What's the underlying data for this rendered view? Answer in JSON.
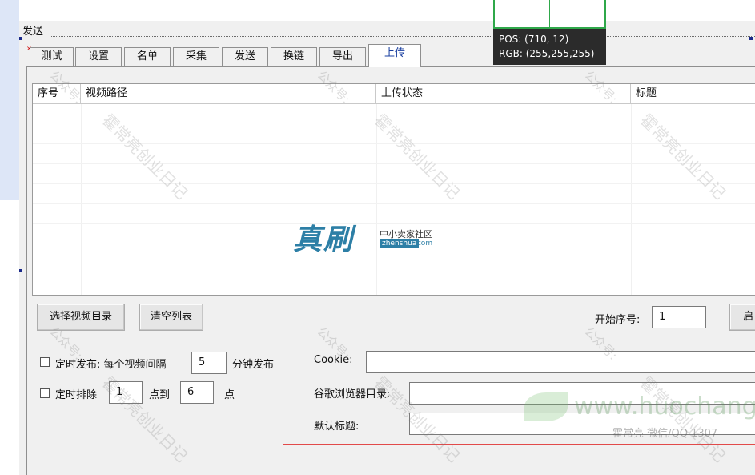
{
  "group": {
    "title": "发送"
  },
  "tabs": [
    {
      "label": "测试"
    },
    {
      "label": "设置"
    },
    {
      "label": "名单"
    },
    {
      "label": "采集"
    },
    {
      "label": "发送"
    },
    {
      "label": "换链"
    },
    {
      "label": "导出"
    },
    {
      "label": "上传",
      "active": true
    }
  ],
  "list": {
    "columns": [
      {
        "label": "序号"
      },
      {
        "label": "视频路径"
      },
      {
        "label": "上传状态"
      },
      {
        "label": "标题"
      }
    ],
    "rows": []
  },
  "buttons": {
    "select_dir": "选择视频目录",
    "clear_list": "清空列表",
    "start_partial": "启"
  },
  "start_index": {
    "label": "开始序号:",
    "value": "1"
  },
  "timed_publish": {
    "label_prefix": "定时发布: 每个视频间隔",
    "value": "5",
    "label_suffix": "分钟发布",
    "checked": false
  },
  "timed_exclude": {
    "label_prefix": "定时排除",
    "from": "1",
    "mid": "点到",
    "to": "6",
    "suffix": "点",
    "checked": false
  },
  "cookie": {
    "label": "Cookie:",
    "value": ""
  },
  "chrome_dir": {
    "label": "谷歌浏览器目录:",
    "value": ""
  },
  "default_title": {
    "label": "默认标题:",
    "value": ""
  },
  "tooltip": {
    "pos": "POS: (710, 12)",
    "rgb": "RGB: (255,255,255)"
  },
  "watermarks": {
    "repeat": "霍常亮创业日记",
    "public": "公众号:",
    "logo_main": "真刷",
    "logo_sub": "中小卖家社区",
    "logo_domain": "zhenshua",
    "logo_tld": ".com",
    "site_url": "www.huochangli",
    "site_desc": "霍常亮 微信/QQ 1307"
  },
  "colors": {
    "active_tab_text": "#1a3fa0",
    "highlight_border": "#e24a4a",
    "tooltip_bg": "#2b2b2b",
    "tooltip_frame": "#2fa84a",
    "left_strip": "#dde6f7"
  }
}
